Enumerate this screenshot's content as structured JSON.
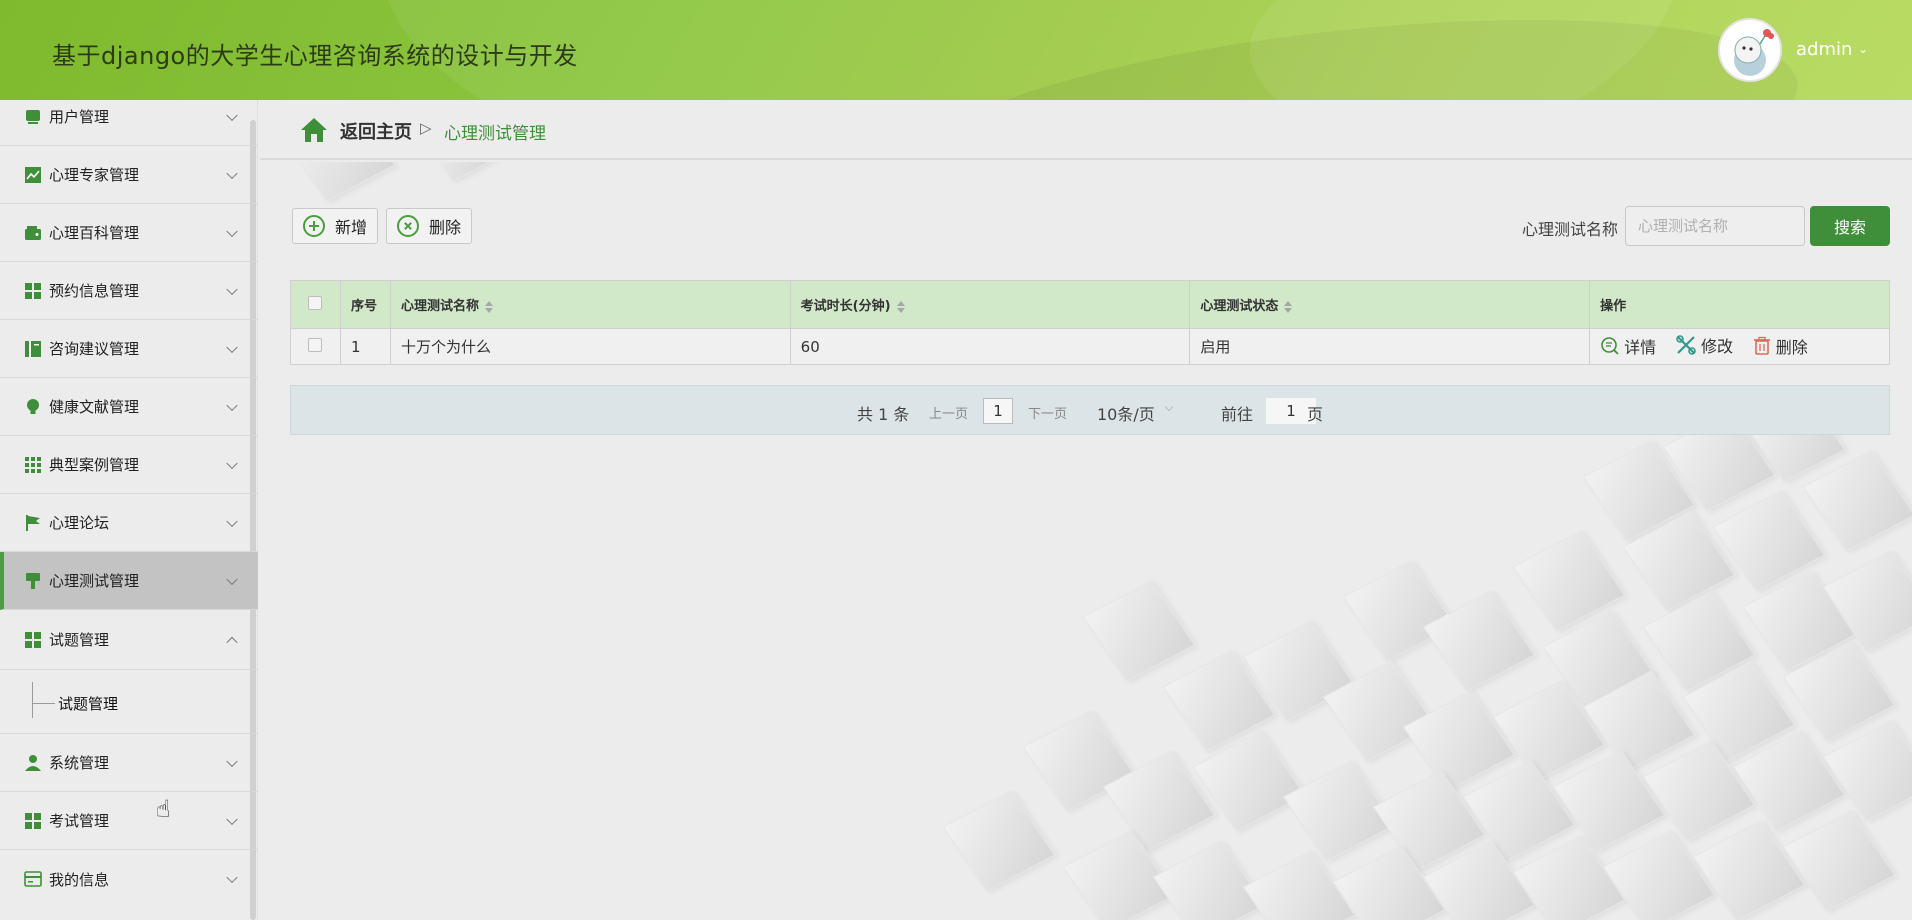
{
  "header": {
    "title": "基于django的大学生心理咨询系统的设计与开发",
    "user_name": "admin"
  },
  "sidebar": {
    "items": [
      {
        "label": "用户管理",
        "icon": "user-card-icon"
      },
      {
        "label": "心理专家管理",
        "icon": "chart-line-icon"
      },
      {
        "label": "心理百科管理",
        "icon": "wallet-icon"
      },
      {
        "label": "预约信息管理",
        "icon": "grid-icon"
      },
      {
        "label": "咨询建议管理",
        "icon": "book-icon"
      },
      {
        "label": "健康文献管理",
        "icon": "bulb-icon"
      },
      {
        "label": "典型案例管理",
        "icon": "apps-icon"
      },
      {
        "label": "心理论坛",
        "icon": "flag-icon"
      },
      {
        "label": "心理测试管理",
        "icon": "brush-icon"
      },
      {
        "label": "试题管理",
        "icon": "grid-icon"
      },
      {
        "label": "系统管理",
        "icon": "person-icon"
      },
      {
        "label": "考试管理",
        "icon": "grid-icon"
      },
      {
        "label": "我的信息",
        "icon": "card-icon"
      }
    ],
    "submenu_label": "试题管理",
    "active_index": 8,
    "expanded_index": 9
  },
  "breadcrumb": {
    "home": "返回主页",
    "separator": "▷",
    "current": "心理测试管理"
  },
  "toolbar": {
    "add_label": "新增",
    "delete_label": "删除",
    "search_label": "心理测试名称",
    "search_placeholder": "心理测试名称",
    "search_button": "搜索"
  },
  "table": {
    "headers": [
      "序号",
      "心理测试名称",
      "考试时长(分钟)",
      "心理测试状态",
      "操作"
    ],
    "rows": [
      {
        "index": "1",
        "name": "十万个为什么",
        "duration": "60",
        "status": "启用"
      }
    ],
    "actions": [
      "详情",
      "修改",
      "删除"
    ]
  },
  "pagination": {
    "total": "共 1 条",
    "prev": "上一页",
    "page": "1",
    "next": "下一页",
    "page_size": "10条/页",
    "goto_label": "前往",
    "goto_value": "1",
    "goto_suffix": "页"
  },
  "colors": {
    "header_green": "#8cc63f",
    "accent_green": "#3f8f3a",
    "table_header": "#d1e8c9"
  }
}
